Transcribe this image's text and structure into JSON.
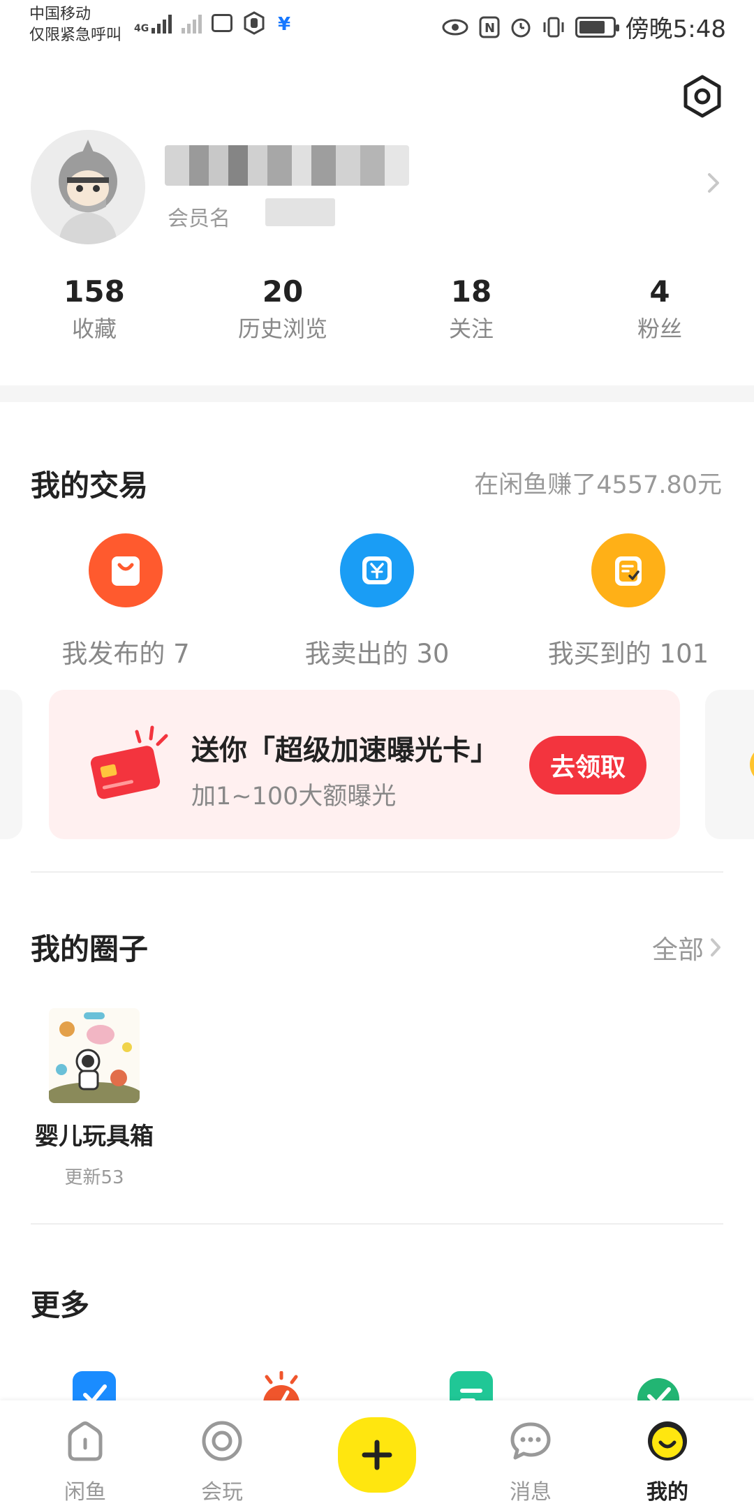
{
  "status_bar": {
    "carrier_line1": "中国移动",
    "carrier_line2": "仅限紧急呼叫",
    "network": "4G",
    "time": "傍晚5:48"
  },
  "profile": {
    "member_label": "会员名"
  },
  "stats": [
    {
      "value": "158",
      "label": "收藏"
    },
    {
      "value": "20",
      "label": "历史浏览"
    },
    {
      "value": "18",
      "label": "关注"
    },
    {
      "value": "4",
      "label": "粉丝"
    }
  ],
  "trades": {
    "title": "我的交易",
    "earned": "在闲鱼赚了4557.80元",
    "items": [
      {
        "label": "我发布的 7",
        "icon": "bag-icon",
        "color": "#ff5a2e"
      },
      {
        "label": "我卖出的 30",
        "icon": "yen-icon",
        "color": "#1a9df5"
      },
      {
        "label": "我买到的 101",
        "icon": "order-icon",
        "color": "#ffb017"
      }
    ]
  },
  "promo": {
    "title": "送你「超级加速曝光卡」",
    "subtitle": "加1~100大额曝光",
    "button": "去领取"
  },
  "circles": {
    "title": "我的圈子",
    "all": "全部",
    "items": [
      {
        "name": "婴儿玩具箱",
        "update": "更新53"
      }
    ]
  },
  "more": {
    "title": "更多"
  },
  "tabbar": {
    "items": [
      {
        "label": "闲鱼"
      },
      {
        "label": "会玩"
      },
      {
        "label": "消息"
      },
      {
        "label": "我的"
      }
    ]
  },
  "colors": {
    "accent_yellow": "#ffe60f",
    "promo_button": "#f3343e",
    "promo_background": "#fff0f0"
  }
}
